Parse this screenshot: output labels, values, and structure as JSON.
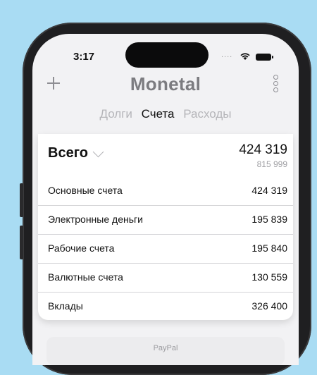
{
  "status_bar": {
    "time": "3:17",
    "signal": "...."
  },
  "header": {
    "title": "Monetal"
  },
  "tabs": [
    {
      "label": "Долги",
      "active": false
    },
    {
      "label": "Счета",
      "active": true
    },
    {
      "label": "Расходы",
      "active": false
    }
  ],
  "summary": {
    "label": "Всего",
    "value": "424 319",
    "secondary_value": "815 999"
  },
  "accounts": [
    {
      "label": "Основные счета",
      "value": "424 319"
    },
    {
      "label": "Электронные деньги",
      "value": "195 839"
    },
    {
      "label": "Рабочие счета",
      "value": "195 840"
    },
    {
      "label": "Валютные счета",
      "value": "130 559"
    },
    {
      "label": "Вклады",
      "value": "326 400"
    }
  ],
  "bottom_item": {
    "label": "PayPal"
  },
  "colors": {
    "background": "#a9dcf3",
    "muted_text": "#8e8e93",
    "active_tab": "#111111"
  }
}
